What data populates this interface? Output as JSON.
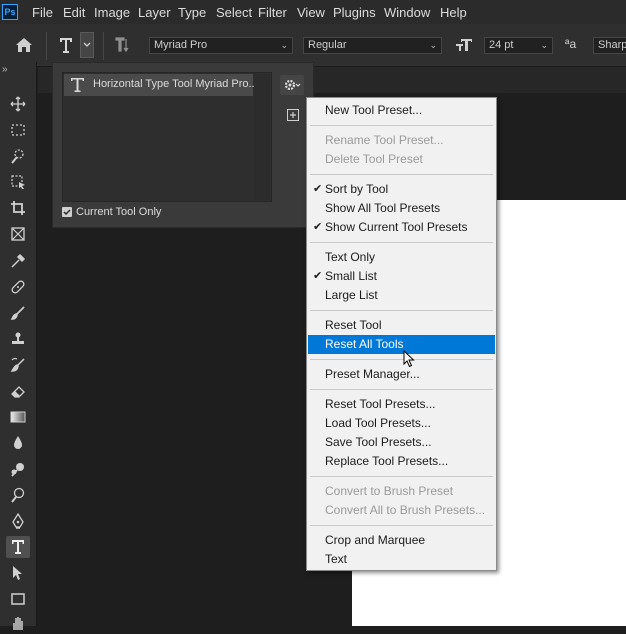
{
  "app": {
    "logo_text": "Ps"
  },
  "menubar": [
    "File",
    "Edit",
    "Image",
    "Layer",
    "Type",
    "Select",
    "Filter",
    "View",
    "Plugins",
    "Window",
    "Help"
  ],
  "options_bar": {
    "font_family": "Myriad Pro",
    "font_style": "Regular",
    "font_size": "24 pt",
    "anti_alias_icon": "aa-icon",
    "anti_alias_value": "Sharp"
  },
  "preset_panel": {
    "item_label": "Horizontal Type Tool Myriad Pro...",
    "current_tool_only_label": "Current Tool Only",
    "current_tool_only_checked": true
  },
  "context_menu": {
    "groups": [
      [
        {
          "label": "New Tool Preset...",
          "enabled": true
        }
      ],
      [
        {
          "label": "Rename Tool Preset...",
          "enabled": false
        },
        {
          "label": "Delete Tool Preset",
          "enabled": false
        }
      ],
      [
        {
          "label": "Sort by Tool",
          "enabled": true,
          "checked": true
        },
        {
          "label": "Show All Tool Presets",
          "enabled": true
        },
        {
          "label": "Show Current Tool Presets",
          "enabled": true,
          "checked": true
        }
      ],
      [
        {
          "label": "Text Only",
          "enabled": true
        },
        {
          "label": "Small List",
          "enabled": true,
          "checked": true
        },
        {
          "label": "Large List",
          "enabled": true
        }
      ],
      [
        {
          "label": "Reset Tool",
          "enabled": true
        },
        {
          "label": "Reset All Tools",
          "enabled": true,
          "highlighted": true
        }
      ],
      [
        {
          "label": "Preset Manager...",
          "enabled": true
        }
      ],
      [
        {
          "label": "Reset Tool Presets...",
          "enabled": true
        },
        {
          "label": "Load Tool Presets...",
          "enabled": true
        },
        {
          "label": "Save Tool Presets...",
          "enabled": true
        },
        {
          "label": "Replace Tool Presets...",
          "enabled": true
        }
      ],
      [
        {
          "label": "Convert to Brush Preset",
          "enabled": false
        },
        {
          "label": "Convert All to Brush Presets...",
          "enabled": false
        }
      ],
      [
        {
          "label": "Crop and Marquee",
          "enabled": true
        },
        {
          "label": "Text",
          "enabled": true
        }
      ]
    ],
    "highlight_color": "#0078d7"
  },
  "toolbar": {
    "tools": [
      "move-tool-icon",
      "marquee-tool-icon",
      "quick-selection-tool-icon",
      "object-selection-tool-icon",
      "crop-tool-icon",
      "frame-tool-icon",
      "eyedropper-tool-icon",
      "spot-healing-tool-icon",
      "brush-tool-icon",
      "clone-stamp-tool-icon",
      "history-brush-tool-icon",
      "eraser-tool-icon",
      "gradient-tool-icon",
      "blur-tool-icon",
      "dodge-tool-icon",
      "burn-tool-icon",
      "pen-tool-icon",
      "type-tool-icon",
      "path-selection-tool-icon",
      "rectangle-tool-icon",
      "hand-tool-icon"
    ],
    "active_tool": "type-tool-icon"
  }
}
